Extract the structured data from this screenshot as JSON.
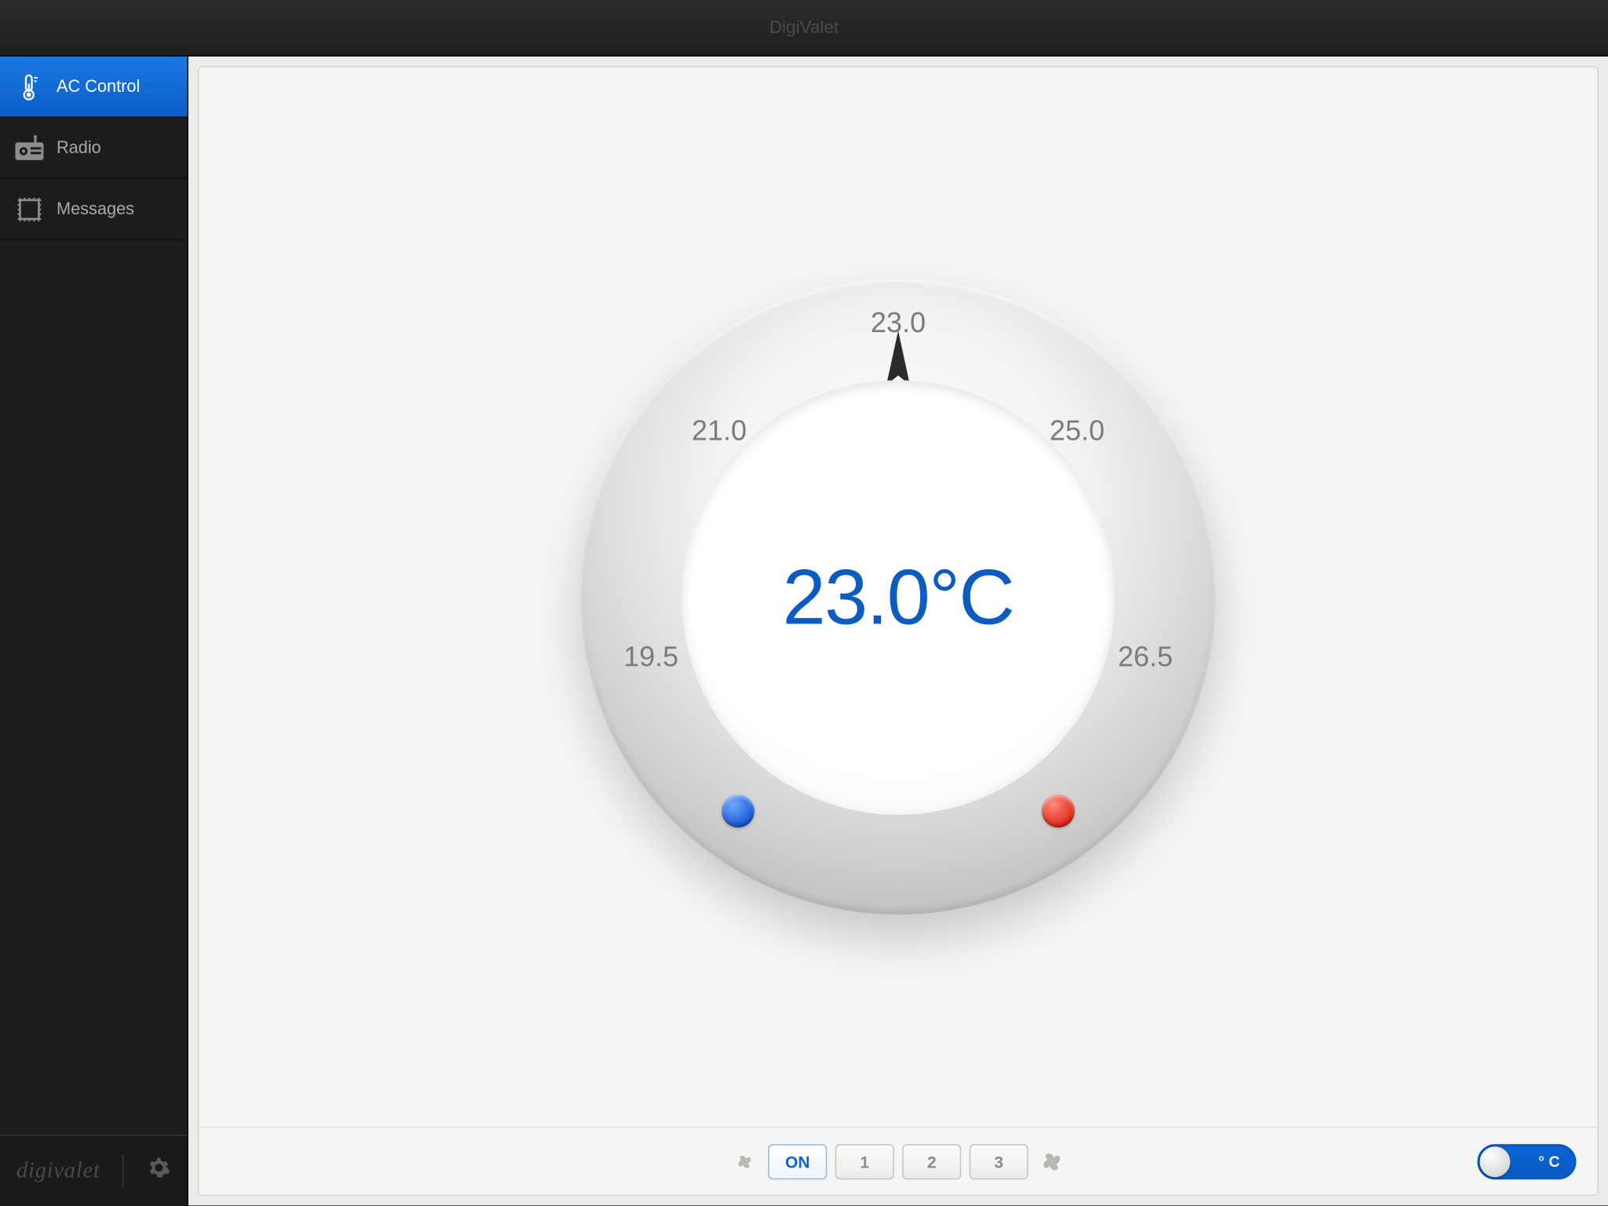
{
  "header": {
    "title": "DigiValet"
  },
  "sidebar": {
    "items": [
      {
        "label": "AC Control",
        "icon": "thermometer-icon",
        "active": true
      },
      {
        "label": "Radio",
        "icon": "radio-icon",
        "active": false
      },
      {
        "label": "Messages",
        "icon": "stamp-icon",
        "active": false
      }
    ],
    "brand": "digivalet"
  },
  "ac": {
    "display": "23.0°C",
    "current_value": 23.0,
    "unit": "°C",
    "ticks": {
      "top": "23.0",
      "upper_left": "21.0",
      "upper_right": "25.0",
      "lower_left": "19.5",
      "lower_right": "26.5"
    },
    "fan": {
      "on_label": "ON",
      "speeds": [
        "1",
        "2",
        "3"
      ],
      "selected": "ON"
    },
    "unit_toggle": {
      "label": "° C"
    },
    "colors": {
      "accent_blue": "#0a5ec7",
      "cold_dot": "#1a5ad6",
      "hot_dot": "#e02b1a"
    }
  }
}
